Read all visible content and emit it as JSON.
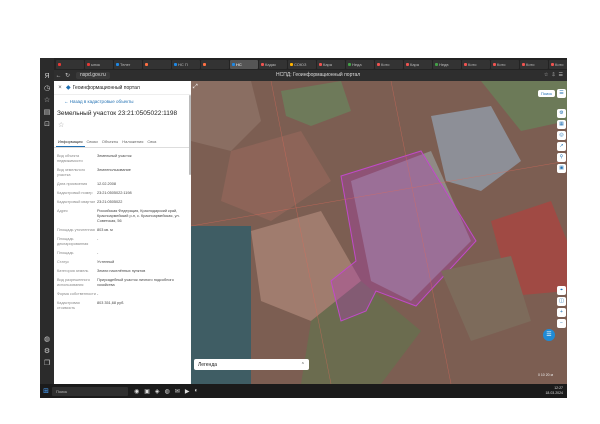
{
  "browser": {
    "tabs": [
      {
        "label": "",
        "color": "#e53935"
      },
      {
        "label": "ынок",
        "color": "#e53935"
      },
      {
        "label": "Телег",
        "color": "#1e88e5"
      },
      {
        "label": "",
        "color": "#ff7043"
      },
      {
        "label": "НС П",
        "color": "#1e88e5"
      },
      {
        "label": "",
        "color": "#ff7043"
      },
      {
        "label": "НС",
        "color": "#1e88e5",
        "active": true
      },
      {
        "label": "Кадас",
        "color": "#ef5350"
      },
      {
        "label": "СОЮЗ",
        "color": "#ffb300"
      },
      {
        "label": "Кара",
        "color": "#ef5350"
      },
      {
        "label": "Неда",
        "color": "#43a047"
      },
      {
        "label": "Кото",
        "color": "#ef5350"
      },
      {
        "label": "Кара",
        "color": "#ef5350"
      },
      {
        "label": "Недв",
        "color": "#43a047"
      },
      {
        "label": "Кото",
        "color": "#ef5350"
      },
      {
        "label": "Кото",
        "color": "#ef5350"
      },
      {
        "label": "Кото",
        "color": "#ef5350"
      },
      {
        "label": "Кото",
        "color": "#ef5350"
      },
      {
        "label": "Хими",
        "color": "#1e88e5"
      },
      {
        "label": "",
        "color": "#ef5350"
      },
      {
        "label": "Кото",
        "color": "#ef5350"
      },
      {
        "label": "Кото",
        "color": "#ef5350"
      },
      {
        "label": "",
        "color": "#ef5350"
      }
    ],
    "url": "nspd.gov.ru",
    "page_title": "НСПД: Геоинформационный портал",
    "left_icons": [
      "Я",
      "◷",
      "☆",
      "▤",
      "⊡",
      "◍",
      "⚙",
      "❐"
    ]
  },
  "panel": {
    "header_title": "Геоинформационный портал",
    "back_link": "Назад в кадастровые объекты",
    "object_title": "Земельный участок 23:21:0505022:1198",
    "tabs": [
      {
        "label": "Информация",
        "active": true
      },
      {
        "label": "Связи"
      },
      {
        "label": "Объекты"
      },
      {
        "label": "Наложения"
      },
      {
        "label": "Связ"
      }
    ],
    "rows": [
      {
        "key": "Вид объекта недвижимости",
        "value": "Земельный участок"
      },
      {
        "key": "Вид земельного участка",
        "value": "Землепользование"
      },
      {
        "key": "Дата присвоения",
        "value": "12.02.2008"
      },
      {
        "key": "Кадастровый номер",
        "value": "23:21:0505022:1198"
      },
      {
        "key": "Кадастровый квартал",
        "value": "23:21:0505022"
      },
      {
        "key": "Адрес",
        "value": "Российская Федерация, Краснодарский край, Красноармейский р-н, с. Красноармейская, ул. Советская, 56"
      },
      {
        "key": "Площадь уточненная",
        "value": "803 кв. м"
      },
      {
        "key": "Площадь декларированная",
        "value": "-"
      },
      {
        "key": "Площадь",
        "value": "-"
      },
      {
        "key": "Статус",
        "value": "Учтенный"
      },
      {
        "key": "Категория земель",
        "value": "Земли населённых пунктов"
      },
      {
        "key": "Вид разрешенного использования",
        "value": "Приусадебный участок личного подсобного хозяйства"
      },
      {
        "key": "Форма собственности",
        "value": "-"
      },
      {
        "key": "Кадастровая стоимость",
        "value": "803 351,68 руб."
      }
    ]
  },
  "map": {
    "search_btn": "Поиск",
    "legend_label": "Легенда",
    "scale_text": "0 10 20 м",
    "side_buttons": [
      "⚙",
      "▦",
      "◎",
      "↗",
      "⚲",
      "▣",
      "◫"
    ],
    "zoom_in": "+",
    "zoom_out": "−"
  },
  "taskbar": {
    "search_placeholder": "Поиск",
    "time": "12:27",
    "date": "18.03.2024",
    "apps": [
      "⊞",
      "◉",
      "▣",
      "◈",
      "◍",
      "✉",
      "▶",
      "◐"
    ]
  }
}
